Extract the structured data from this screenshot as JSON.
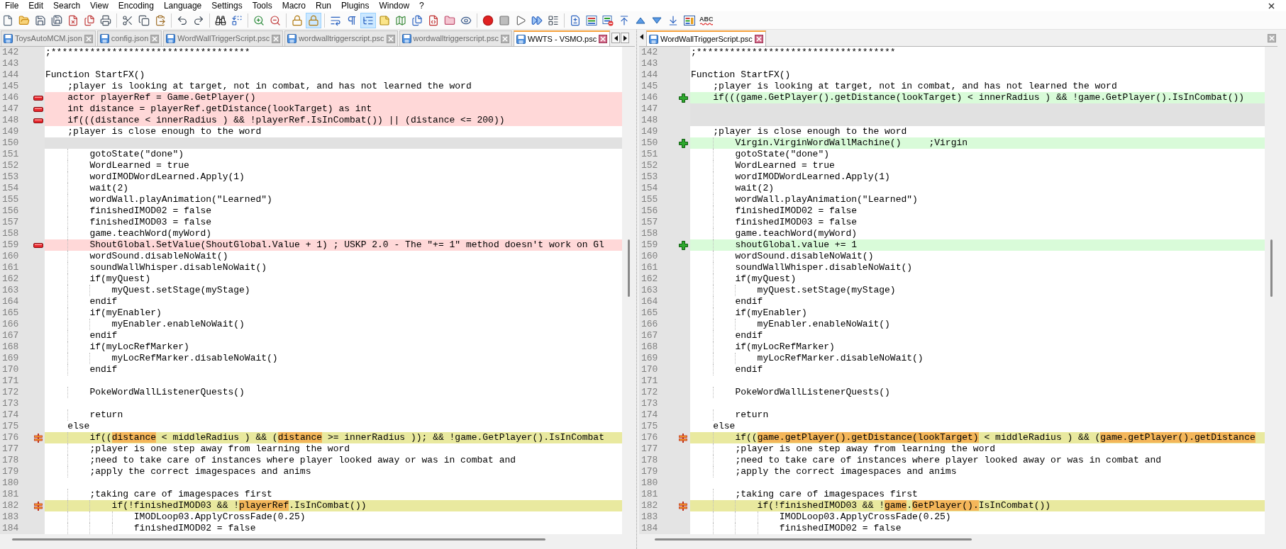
{
  "menu_bar": [
    "File",
    "Edit",
    "Search",
    "View",
    "Encoding",
    "Language",
    "Settings",
    "Tools",
    "Macro",
    "Run",
    "Plugins",
    "Window",
    "?"
  ],
  "toolbar": [
    {
      "on": false
    },
    {
      "on": false
    },
    {
      "on": false
    },
    {
      "on": false
    },
    {
      "on": false
    },
    {
      "on": false
    },
    {
      "on": false
    },
    {
      "on": false
    },
    {
      "on": false
    },
    {
      "on": false
    },
    {
      "on": false
    },
    {
      "on": false
    },
    {
      "on": false
    },
    {
      "on": false
    },
    {
      "on": false
    },
    {
      "on": false
    },
    {
      "on": false
    },
    {
      "on": true
    },
    {
      "on": false
    },
    {
      "on": false
    },
    {
      "on": true
    },
    {
      "on": false
    },
    {
      "on": false
    },
    {
      "on": false
    },
    {
      "on": false
    },
    {
      "on": false
    },
    {
      "on": false
    },
    {
      "on": false
    },
    {
      "on": false
    },
    {
      "on": false
    },
    {
      "on": false
    },
    {
      "on": false
    },
    {
      "on": false
    },
    {
      "on": false
    },
    {
      "on": false
    },
    {
      "on": false
    },
    {
      "on": false
    },
    {
      "on": false
    },
    {
      "on": false
    },
    {
      "on": false
    }
  ],
  "spell_check": {
    "label": "ABC"
  },
  "panes": [
    {
      "tabs": [
        {
          "label": "ToysAutoMCM.json",
          "selected": false
        },
        {
          "label": "config.json",
          "selected": false
        },
        {
          "label": "WordWallTriggerScript.psc",
          "selected": false
        },
        {
          "label": "wordwalltriggerscript.psc",
          "selected": false
        },
        {
          "label": "wordwalltriggerscript.psc",
          "selected": false
        },
        {
          "label": "WWTS - VSMO.psc",
          "selected": true
        }
      ],
      "lines": [
        {
          "number": "142",
          "kind": "normal",
          "text": ";************************************"
        },
        {
          "number": "143",
          "kind": "normal"
        },
        {
          "number": "144",
          "kind": "normal",
          "text": "Function StartFX()"
        },
        {
          "number": "145",
          "kind": "normal",
          "text": "    ;player is looking at target, not in combat, and has not learned the word"
        },
        {
          "number": "146",
          "kind": "removed",
          "text": "    actor playerRef = Game.GetPlayer()"
        },
        {
          "number": "147",
          "kind": "removed",
          "text": "    int distance = playerRef.getDistance(lookTarget) as int"
        },
        {
          "number": "148",
          "kind": "removed",
          "text": "    if(((distance < innerRadius ) && !playerRef.IsInCombat()) || (distance <= 200))"
        },
        {
          "number": "149",
          "kind": "normal",
          "text": "    ;player is close enough to the word"
        },
        {
          "number": "150",
          "kind": "blank"
        },
        {
          "number": "151",
          "kind": "normal",
          "text": "        gotoState(\"done\")"
        },
        {
          "number": "152",
          "kind": "normal",
          "text": "        WordLearned = true"
        },
        {
          "number": "153",
          "kind": "normal",
          "text": "        wordIMODWordLearned.Apply(1)"
        },
        {
          "number": "154",
          "kind": "normal",
          "text": "        wait(2)"
        },
        {
          "number": "155",
          "kind": "normal",
          "text": "        wordWall.playAnimation(\"Learned\")"
        },
        {
          "number": "156",
          "kind": "normal",
          "text": "        finishedIMOD02 = false"
        },
        {
          "number": "157",
          "kind": "normal",
          "text": "        finishedIMOD03 = false"
        },
        {
          "number": "158",
          "kind": "normal",
          "text": "        game.teachWord(myWord)"
        },
        {
          "number": "159",
          "kind": "removed",
          "text": "        ShoutGlobal.SetValue(ShoutGlobal.Value + 1) ; USKP 2.0 - The \"+= 1\" method doesn't work on Gl"
        },
        {
          "number": "160",
          "kind": "normal",
          "text": "        wordSound.disableNoWait()"
        },
        {
          "number": "161",
          "kind": "normal",
          "text": "        soundWallWhisper.disableNoWait()"
        },
        {
          "number": "162",
          "kind": "normal",
          "text": "        if(myQuest)"
        },
        {
          "number": "163",
          "kind": "normal",
          "text": "            myQuest.setStage(myStage)"
        },
        {
          "number": "164",
          "kind": "normal",
          "text": "        endif"
        },
        {
          "number": "165",
          "kind": "normal",
          "text": "        if(myEnabler)"
        },
        {
          "number": "166",
          "kind": "normal",
          "text": "            myEnabler.enableNoWait()"
        },
        {
          "number": "167",
          "kind": "normal",
          "text": "        endif"
        },
        {
          "number": "168",
          "kind": "normal",
          "text": "        if(myLocRefMarker)"
        },
        {
          "number": "169",
          "kind": "normal",
          "text": "            myLocRefMarker.disableNoWait()"
        },
        {
          "number": "170",
          "kind": "normal",
          "text": "        endif"
        },
        {
          "number": "171",
          "kind": "normal"
        },
        {
          "number": "172",
          "kind": "normal",
          "text": "        PokeWordWallListenerQuests()"
        },
        {
          "number": "173",
          "kind": "normal"
        },
        {
          "number": "174",
          "kind": "normal",
          "text": "        return"
        },
        {
          "number": "175",
          "kind": "normal",
          "text": "    else"
        },
        {
          "number": "176",
          "kind": "changed",
          "segments": [
            {
              "text": "        if((",
              "changed": false
            },
            {
              "text": "distance",
              "changed": true
            },
            {
              "text": " < middleRadius ) && (",
              "changed": false
            },
            {
              "text": "distance",
              "changed": true
            },
            {
              "text": " >= innerRadius )); && !game.GetPlayer().IsInCombat",
              "changed": false
            }
          ]
        },
        {
          "number": "177",
          "kind": "normal",
          "text": "        ;player is one step away from learning the word"
        },
        {
          "number": "178",
          "kind": "normal",
          "text": "        ;need to take care of instances where player looked away or was in combat and"
        },
        {
          "number": "179",
          "kind": "normal",
          "text": "        ;apply the correct imagespaces and anims"
        },
        {
          "number": "180",
          "kind": "normal"
        },
        {
          "number": "181",
          "kind": "normal",
          "text": "        ;taking care of imagespaces first"
        },
        {
          "number": "182",
          "kind": "changed",
          "segments": [
            {
              "text": "            if(!finishedIMOD03 && !",
              "changed": false
            },
            {
              "text": "playerRef",
              "changed": true
            },
            {
              "text": ".IsInCombat())",
              "changed": false
            }
          ]
        },
        {
          "number": "183",
          "kind": "normal",
          "text": "                IMODLoop03.ApplyCrossFade(0.25)"
        },
        {
          "number": "184",
          "kind": "normal",
          "text": "                finishedIMOD02 = false"
        }
      ]
    },
    {
      "tabs": [
        {
          "label": "WordWallTriggerScript.psc",
          "selected": true
        }
      ],
      "lines": [
        {
          "number": "142",
          "kind": "normal",
          "text": ";************************************"
        },
        {
          "number": "143",
          "kind": "normal"
        },
        {
          "number": "144",
          "kind": "normal",
          "text": "Function StartFX()"
        },
        {
          "number": "145",
          "kind": "normal",
          "text": "    ;player is looking at target, not in combat, and has not learned the word"
        },
        {
          "number": "146",
          "kind": "added",
          "text": "    if(((game.GetPlayer().getDistance(lookTarget) < innerRadius ) && !game.GetPlayer().IsInCombat())"
        },
        {
          "number": "147",
          "kind": "blank"
        },
        {
          "number": "148",
          "kind": "blank"
        },
        {
          "number": "149",
          "kind": "normal",
          "text": "    ;player is close enough to the word"
        },
        {
          "number": "150",
          "kind": "added",
          "text": "        Virgin.VirginWordWallMachine()     ;Virgin"
        },
        {
          "number": "151",
          "kind": "normal",
          "text": "        gotoState(\"done\")"
        },
        {
          "number": "152",
          "kind": "normal",
          "text": "        WordLearned = true"
        },
        {
          "number": "153",
          "kind": "normal",
          "text": "        wordIMODWordLearned.Apply(1)"
        },
        {
          "number": "154",
          "kind": "normal",
          "text": "        wait(2)"
        },
        {
          "number": "155",
          "kind": "normal",
          "text": "        wordWall.playAnimation(\"Learned\")"
        },
        {
          "number": "156",
          "kind": "normal",
          "text": "        finishedIMOD02 = false"
        },
        {
          "number": "157",
          "kind": "normal",
          "text": "        finishedIMOD03 = false"
        },
        {
          "number": "158",
          "kind": "normal",
          "text": "        game.teachWord(myWord)"
        },
        {
          "number": "159",
          "kind": "added",
          "text": "        shoutGlobal.value += 1"
        },
        {
          "number": "160",
          "kind": "normal",
          "text": "        wordSound.disableNoWait()"
        },
        {
          "number": "161",
          "kind": "normal",
          "text": "        soundWallWhisper.disableNoWait()"
        },
        {
          "number": "162",
          "kind": "normal",
          "text": "        if(myQuest)"
        },
        {
          "number": "163",
          "kind": "normal",
          "text": "            myQuest.setStage(myStage)"
        },
        {
          "number": "164",
          "kind": "normal",
          "text": "        endif"
        },
        {
          "number": "165",
          "kind": "normal",
          "text": "        if(myEnabler)"
        },
        {
          "number": "166",
          "kind": "normal",
          "text": "            myEnabler.enableNoWait()"
        },
        {
          "number": "167",
          "kind": "normal",
          "text": "        endif"
        },
        {
          "number": "168",
          "kind": "normal",
          "text": "        if(myLocRefMarker)"
        },
        {
          "number": "169",
          "kind": "normal",
          "text": "            myLocRefMarker.disableNoWait()"
        },
        {
          "number": "170",
          "kind": "normal",
          "text": "        endif"
        },
        {
          "number": "171",
          "kind": "normal"
        },
        {
          "number": "172",
          "kind": "normal",
          "text": "        PokeWordWallListenerQuests()"
        },
        {
          "number": "173",
          "kind": "normal"
        },
        {
          "number": "174",
          "kind": "normal",
          "text": "        return"
        },
        {
          "number": "175",
          "kind": "normal",
          "text": "    else"
        },
        {
          "number": "176",
          "kind": "changed",
          "segments": [
            {
              "text": "        if((",
              "changed": false
            },
            {
              "text": "game.getPlayer().getDistance(lookTarget)",
              "changed": true
            },
            {
              "text": " < middleRadius ) && (",
              "changed": false
            },
            {
              "text": "game.getPlayer().getDistance",
              "changed": true
            }
          ]
        },
        {
          "number": "177",
          "kind": "normal",
          "text": "        ;player is one step away from learning the word"
        },
        {
          "number": "178",
          "kind": "normal",
          "text": "        ;need to take care of instances where player looked away or was in combat and"
        },
        {
          "number": "179",
          "kind": "normal",
          "text": "        ;apply the correct imagespaces and anims"
        },
        {
          "number": "180",
          "kind": "normal"
        },
        {
          "number": "181",
          "kind": "normal",
          "text": "        ;taking care of imagespaces first"
        },
        {
          "number": "182",
          "kind": "changed",
          "segments": [
            {
              "text": "            if(!finishedIMOD03 && !",
              "changed": false
            },
            {
              "text": "game",
              "changed": true
            },
            {
              "text": ".",
              "changed": false
            },
            {
              "text": "GetPlayer().",
              "changed": true
            },
            {
              "text": "IsInCombat())",
              "changed": false
            }
          ]
        },
        {
          "number": "183",
          "kind": "normal",
          "text": "                IMODLoop03.ApplyCrossFade(0.25)"
        },
        {
          "number": "184",
          "kind": "normal",
          "text": "                finishedIMOD02 = false"
        }
      ]
    }
  ]
}
